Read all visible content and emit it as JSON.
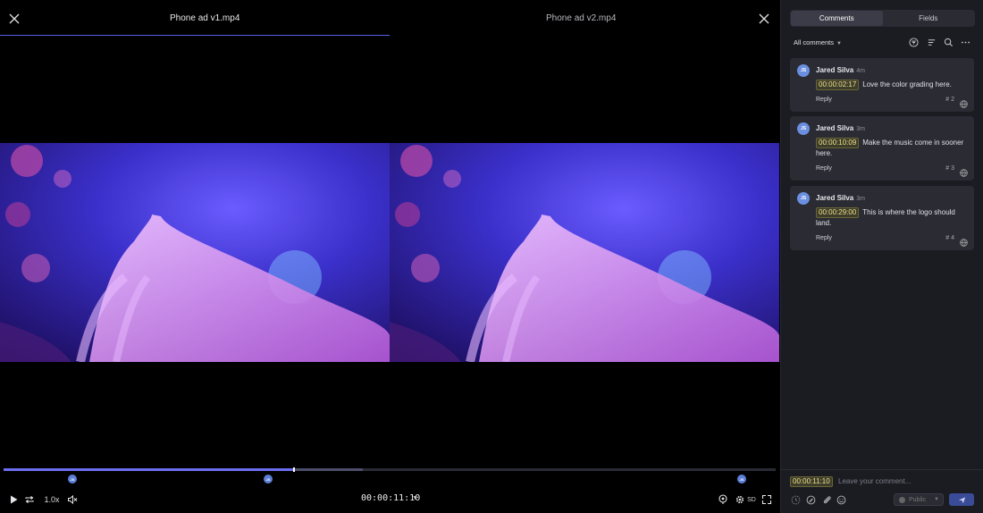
{
  "viewer": {
    "tabs": [
      {
        "title": "Phone ad v1.mp4"
      },
      {
        "title": "Phone ad v2.mp4"
      }
    ],
    "playback": {
      "speed": "1.0x",
      "timecode": "00:00:11:10",
      "quality": "SD",
      "progress": 0.375,
      "buffered": 0.465
    },
    "markers": [
      {
        "initials": "JS"
      },
      {
        "initials": "JS"
      },
      {
        "initials": "JS"
      }
    ]
  },
  "panel": {
    "tabs": {
      "comments": "Comments",
      "fields": "Fields"
    },
    "filter_label": "All comments",
    "comments": [
      {
        "initials": "JS",
        "author": "Jared Silva",
        "time": "4m",
        "timecode": "00:00:02:17",
        "text": "Love the color grading here.",
        "reply": "Reply",
        "number": "# 2"
      },
      {
        "initials": "JS",
        "author": "Jared Silva",
        "time": "3m",
        "timecode": "00:00:10:09",
        "text": "Make the music come in sooner here.",
        "reply": "Reply",
        "number": "# 3"
      },
      {
        "initials": "JS",
        "author": "Jared Silva",
        "time": "3m",
        "timecode": "00:00:29:00",
        "text": "This is where the logo should land.",
        "reply": "Reply",
        "number": "# 4"
      }
    ],
    "composer": {
      "timecode": "00:00:11:10",
      "placeholder": "Leave your comment...",
      "visibility": "Public"
    }
  },
  "colors": {
    "accent": "#5b5fe6",
    "timecode_text": "#f2e08a",
    "avatar": "#6b8fe0"
  }
}
